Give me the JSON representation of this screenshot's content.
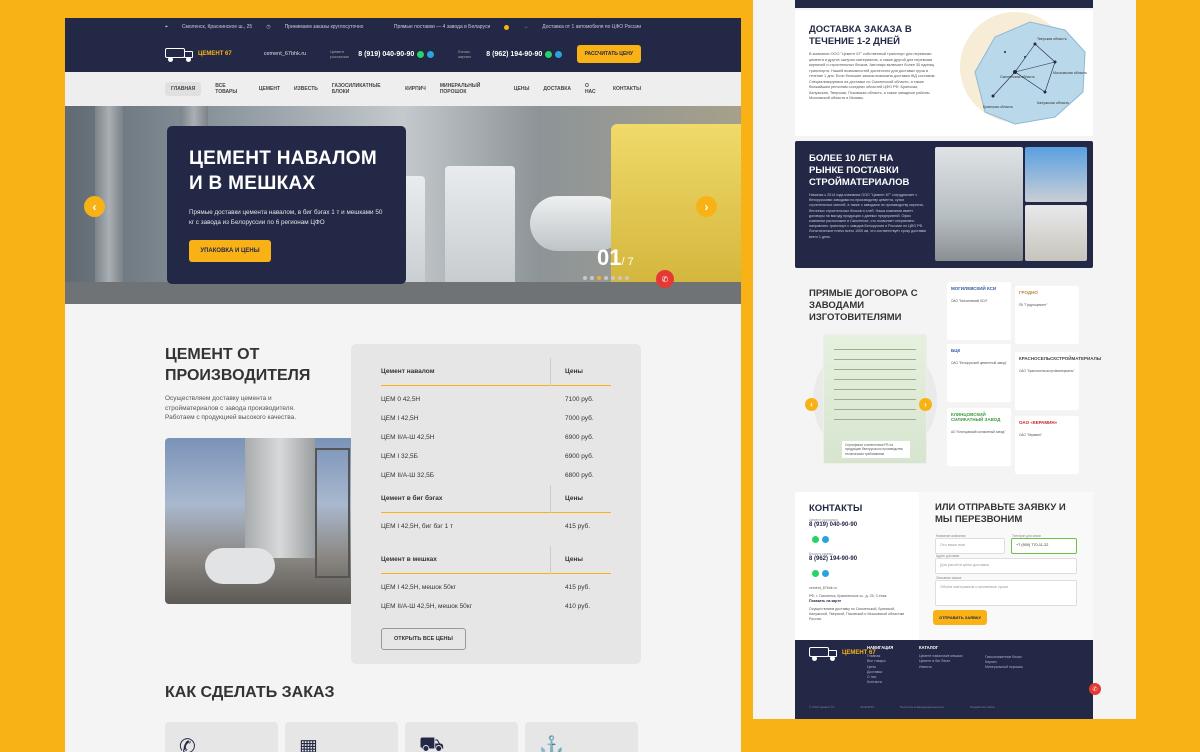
{
  "left": {
    "topbar": {
      "address": "Смоленск, Краснинское ш., 25",
      "hours": "Принимаем заказы круглосуточно",
      "supply": "Прямые поставки — 4 завода в Беларуси",
      "delivery": "Доставка от 1 автомобиля по ЦФО России"
    },
    "header": {
      "logo": "ЦЕМЕНТ 67",
      "email": "cement_67bhk.ru",
      "label1": "Цемент россыпью",
      "phone1": "8 (919) 040-90-90",
      "label2": "Блоки, кирпич",
      "phone2": "8 (962) 194-90-90",
      "calc_button": "РАССЧИТАТЬ ЦЕНУ"
    },
    "nav": [
      "ГЛАВНАЯ",
      "ВСЕ ТОВАРЫ",
      "ЦЕМЕНТ",
      "ИЗВЕСТЬ",
      "ГАЗОСИЛИКАТНЫЕ БЛОКИ",
      "КИРПИЧ",
      "МИНЕРАЛЬНЫЙ ПОРОШОК",
      "ЦЕНЫ",
      "ДОСТАВКА",
      "О НАС",
      "КОНТАКТЫ"
    ],
    "hero": {
      "title_line1": "ЦЕМЕНТ НАВАЛОМ",
      "title_line2": "И В МЕШКАХ",
      "text": "Прямые доставки цемента навалом, в биг бэгах 1 т и мешками 50 кг с завода из Белоруссии по 6 регионам ЦФО",
      "button": "УПАКОВКА И ЦЕНЫ",
      "slide_current": "01",
      "slide_total": "/ 7",
      "arrow_left": "‹",
      "arrow_right": "›"
    },
    "about": {
      "title": "ЦЕМЕНТ ОТ ПРОИЗВОДИТЕЛЯ",
      "text": "Осуществляем доставку цемента и стройматериалов с завода производителя. Работаем с продукцией высокого качества."
    },
    "prices": {
      "groups": [
        {
          "name": "Цемент навалом",
          "price_head": "Цены",
          "rows": [
            {
              "n": "ЦЕМ 0 42,5Н",
              "p": "7100 руб."
            },
            {
              "n": "ЦЕМ I 42,5Н",
              "p": "7000 руб."
            },
            {
              "n": "ЦЕМ II/А-Ш 42,5Н",
              "p": "6900 руб."
            },
            {
              "n": "ЦЕМ I 32,5Б",
              "p": "6900 руб."
            },
            {
              "n": "ЦЕМ II/А-Ш 32,5Б",
              "p": "6800 руб."
            }
          ]
        },
        {
          "name": "Цемент в биг бэгах",
          "price_head": "Цены",
          "rows": [
            {
              "n": "ЦЕМ I 42,5Н, биг бэг 1 т",
              "p": "415 руб."
            }
          ]
        },
        {
          "name": "Цемент в мешках",
          "price_head": "Цены",
          "rows": [
            {
              "n": "ЦЕМ I 42,5Н, мешок 50кг",
              "p": "415 руб."
            },
            {
              "n": "ЦЕМ II/А-Ш 42,5Н, мешок 50кг",
              "p": "410 руб."
            }
          ]
        }
      ],
      "button": "ОТКРЫТЬ ВСЕ ЦЕНЫ"
    },
    "howto": {
      "title": "КАК СДЕЛАТЬ ЗАКАЗ"
    }
  },
  "right": {
    "delivery": {
      "title": "ДОСТАВКА ЗАКАЗА В ТЕЧЕНИЕ 1-2 ДНЕЙ",
      "text": "В компании ООО \"Цемент 67\" собственный транспорт для перевозки цемента и других сыпучих материалов, а также другой для перевозки кирпичей и строительных блоков. Автопарк включает более 30 единиц транспорта. Нашей возможностей достаточно для доставки груза в течение 1 дня. Если большие заказы возможна доставка ЖД составом. Специализируемся на доставке по Смоленской области, а также ближайшим регионам соседних областей ЦФО РФ: Брянская, Калужская, Тверская, Псковская область, а также западные районы Московской области и Москвы.",
      "regions": [
        "Тверская область",
        "Смоленская область",
        "Московская область",
        "Калужская область",
        "Брянская область"
      ]
    },
    "experience": {
      "title": "БОЛЕЕ 10 ЛЕТ НА РЫНКЕ ПОСТАВКИ СТРОЙМАТЕРИАЛОВ",
      "text": "Начиная с 2014 года компания ООО \"Цемент 67\" сотрудничает с белорусскими заводами по производству цемента, сухих строительных смесей, а также с заводами по производству кирпича, бетонных строительных блоков и хлеб. Наша компания имеет договоры на выгоду продукции с данных предприятий. Офис компании расположен в Смоленске, что позволяет оперативно направлять транспорт с заводов Белоруссии и Россиии по ЦФО РФ. Логистическое плечо всего 1000 км, что соответствует сроку доставки всего 1 день."
    },
    "contracts": {
      "title": "ПРЯМЫЕ ДОГОВОРА С ЗАВОДАМИ ИЗГОТОВИТЕЛЯМИ",
      "cert_caption": "Сертификат соответствия РБ на продукцию белорусского производства техническим требованиям",
      "logos": [
        {
          "name": "МОГИЛЕВСКИЙ КСИ",
          "cap": "ОАО \"Могилевский КСИ\""
        },
        {
          "name": "ГРОДНО",
          "cap": "ПК \"Гродноцемент\""
        },
        {
          "name": "БЦК",
          "cap": "ОАО \"Белорусский цементный завод\""
        },
        {
          "name": "КРАСНОСЕЛЬСКСТРОЙМАТЕРИАЛЫ",
          "cap": "ОАО \"Красносельскстройматериалы\""
        },
        {
          "name": "КЛИНЦОВСКИЙ СИЛИКАТНЫЙ ЗАВОД",
          "cap": "АО \"Клинцовский силикатный завод\""
        },
        {
          "name": "ОАО «КЕРАМИН»",
          "cap": "ОАО \"Керамин\""
        }
      ]
    },
    "contacts": {
      "title": "КОНТАКТЫ",
      "label1": "Цемент россыпью",
      "phone1": "8 (919) 040-90-90",
      "label2": "Блоки и кирпич",
      "phone2": "8 (962) 194-90-90",
      "email": "cement_67bhk.ru",
      "address": "РФ, г. Смоленск, Краснинское ш., д. 25, 3 этаж",
      "map_link": "Показать на карте",
      "note": "Осуществляем доставку по Смоленской, Брянской, Калужской, Тверской, Псковской и Московской областям России."
    },
    "form": {
      "title": "ИЛИ ОТПРАВЬТЕ ЗАЯВКУ И МЫ ПЕРЕЗВОНИМ",
      "name_label": "Название компании",
      "name_ph": "Ото ваше имя",
      "phone_label": "Телефон для связи",
      "phone_val": "+7 (900) 770-11-22",
      "addr_label": "Адрес доставки",
      "addr_ph": "Для расчёта цены доставки",
      "comment_label": "Описание заказа",
      "comment_ph": "Объём материалов и желаемые сроки",
      "button": "ОТПРАВИТЬ ЗАЯВКУ"
    },
    "footer": {
      "logo": "ЦЕМЕНТ 67",
      "nav_head": "НАВИГАЦИЯ",
      "nav_items": [
        "Главная",
        "Все товары",
        "Цены",
        "Доставка",
        "О нас",
        "Контакты"
      ],
      "cat_head": "КАТАЛОГ",
      "cat_items": [
        "Цемент навалом/в мешках",
        "Цемент в биг бэгах",
        "Известь",
        "Газосиликатные блоки",
        "Кирпич",
        "Минеральный порошок"
      ],
      "bottom": [
        "© 2024 Цемент 67",
        "ИНН/КПП",
        "Политика конфиденциальности",
        "Разработка сайта"
      ]
    }
  },
  "colors": {
    "accent": "#f9b216",
    "navy": "#242847"
  }
}
